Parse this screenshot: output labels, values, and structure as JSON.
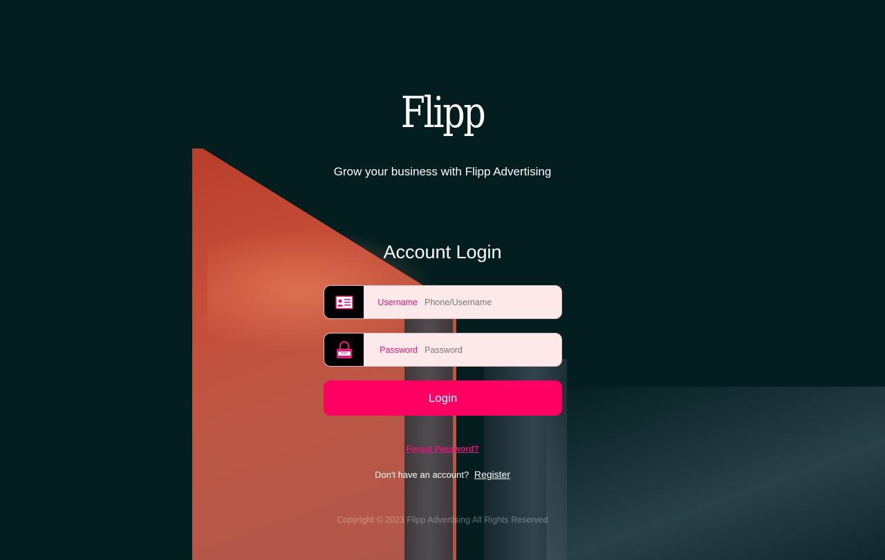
{
  "brand": {
    "logo_text": "Flipp",
    "tagline": "Grow your business with Flipp Advertising"
  },
  "login": {
    "title": "Account Login",
    "username": {
      "icon": "id-card-icon",
      "label": "Username",
      "placeholder": "Phone/Username",
      "value": ""
    },
    "password": {
      "icon": "lock-icon",
      "label": "Password",
      "placeholder": "Password",
      "value": ""
    },
    "submit_label": "Login",
    "forgot_label": "Forgot Password?",
    "register_prompt": "Don't have an account?",
    "register_label": "Register"
  },
  "footer": {
    "copyright": "Copyright © 2023 Flipp Advertising All Rights Reserved"
  },
  "colors": {
    "background": "#041e20",
    "accent": "#ff0062",
    "label": "#e0197a",
    "field_bg": "#fde8ea"
  }
}
